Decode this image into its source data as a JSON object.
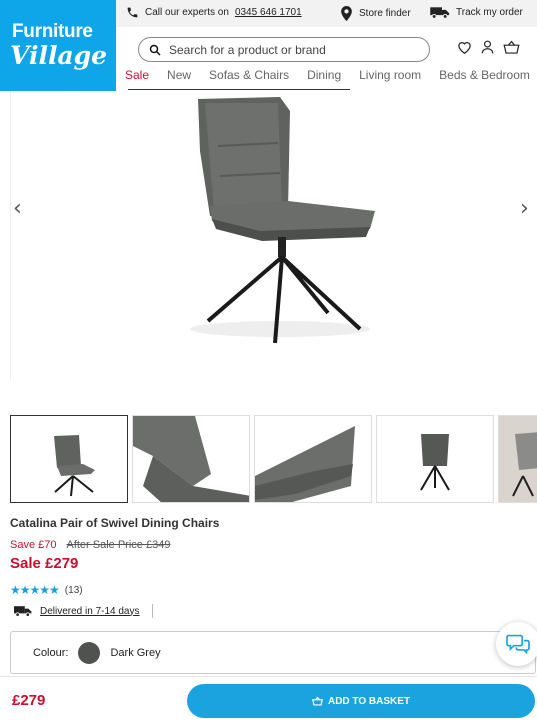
{
  "brand": {
    "line1": "Furniture",
    "line2": "Village"
  },
  "topbar": {
    "call_text": "Call our experts on",
    "phone": "0345 646 1701",
    "store_finder": "Store finder",
    "track_order": "Track my order"
  },
  "search": {
    "placeholder": "Search for a product or brand"
  },
  "nav": {
    "items": [
      "Sale",
      "New",
      "Sofas & Chairs",
      "Dining",
      "Living room",
      "Beds & Bedroom"
    ],
    "active_index": 0
  },
  "gallery": {
    "prev": "‹",
    "next": "›",
    "thumbnail_count": 5,
    "selected_index": 0
  },
  "product": {
    "title": "Catalina Pair of Swivel Dining Chairs",
    "save": "Save £70",
    "was_price": "After Sale Price £349",
    "sale_price": "Sale £279",
    "rating": 4.5,
    "stars": "★★★★★",
    "review_count": "(13)",
    "delivery": "Delivered in 7-14 days",
    "colour_label": "Colour:",
    "colour_value": "Dark Grey"
  },
  "bottom": {
    "price": "£279",
    "basket_label": "ADD TO BASKET"
  },
  "colors": {
    "brand_blue": "#0ea5e9",
    "sale_red": "#c8102e",
    "button_blue": "#1ba3e0",
    "swatch": "#4f524f"
  }
}
